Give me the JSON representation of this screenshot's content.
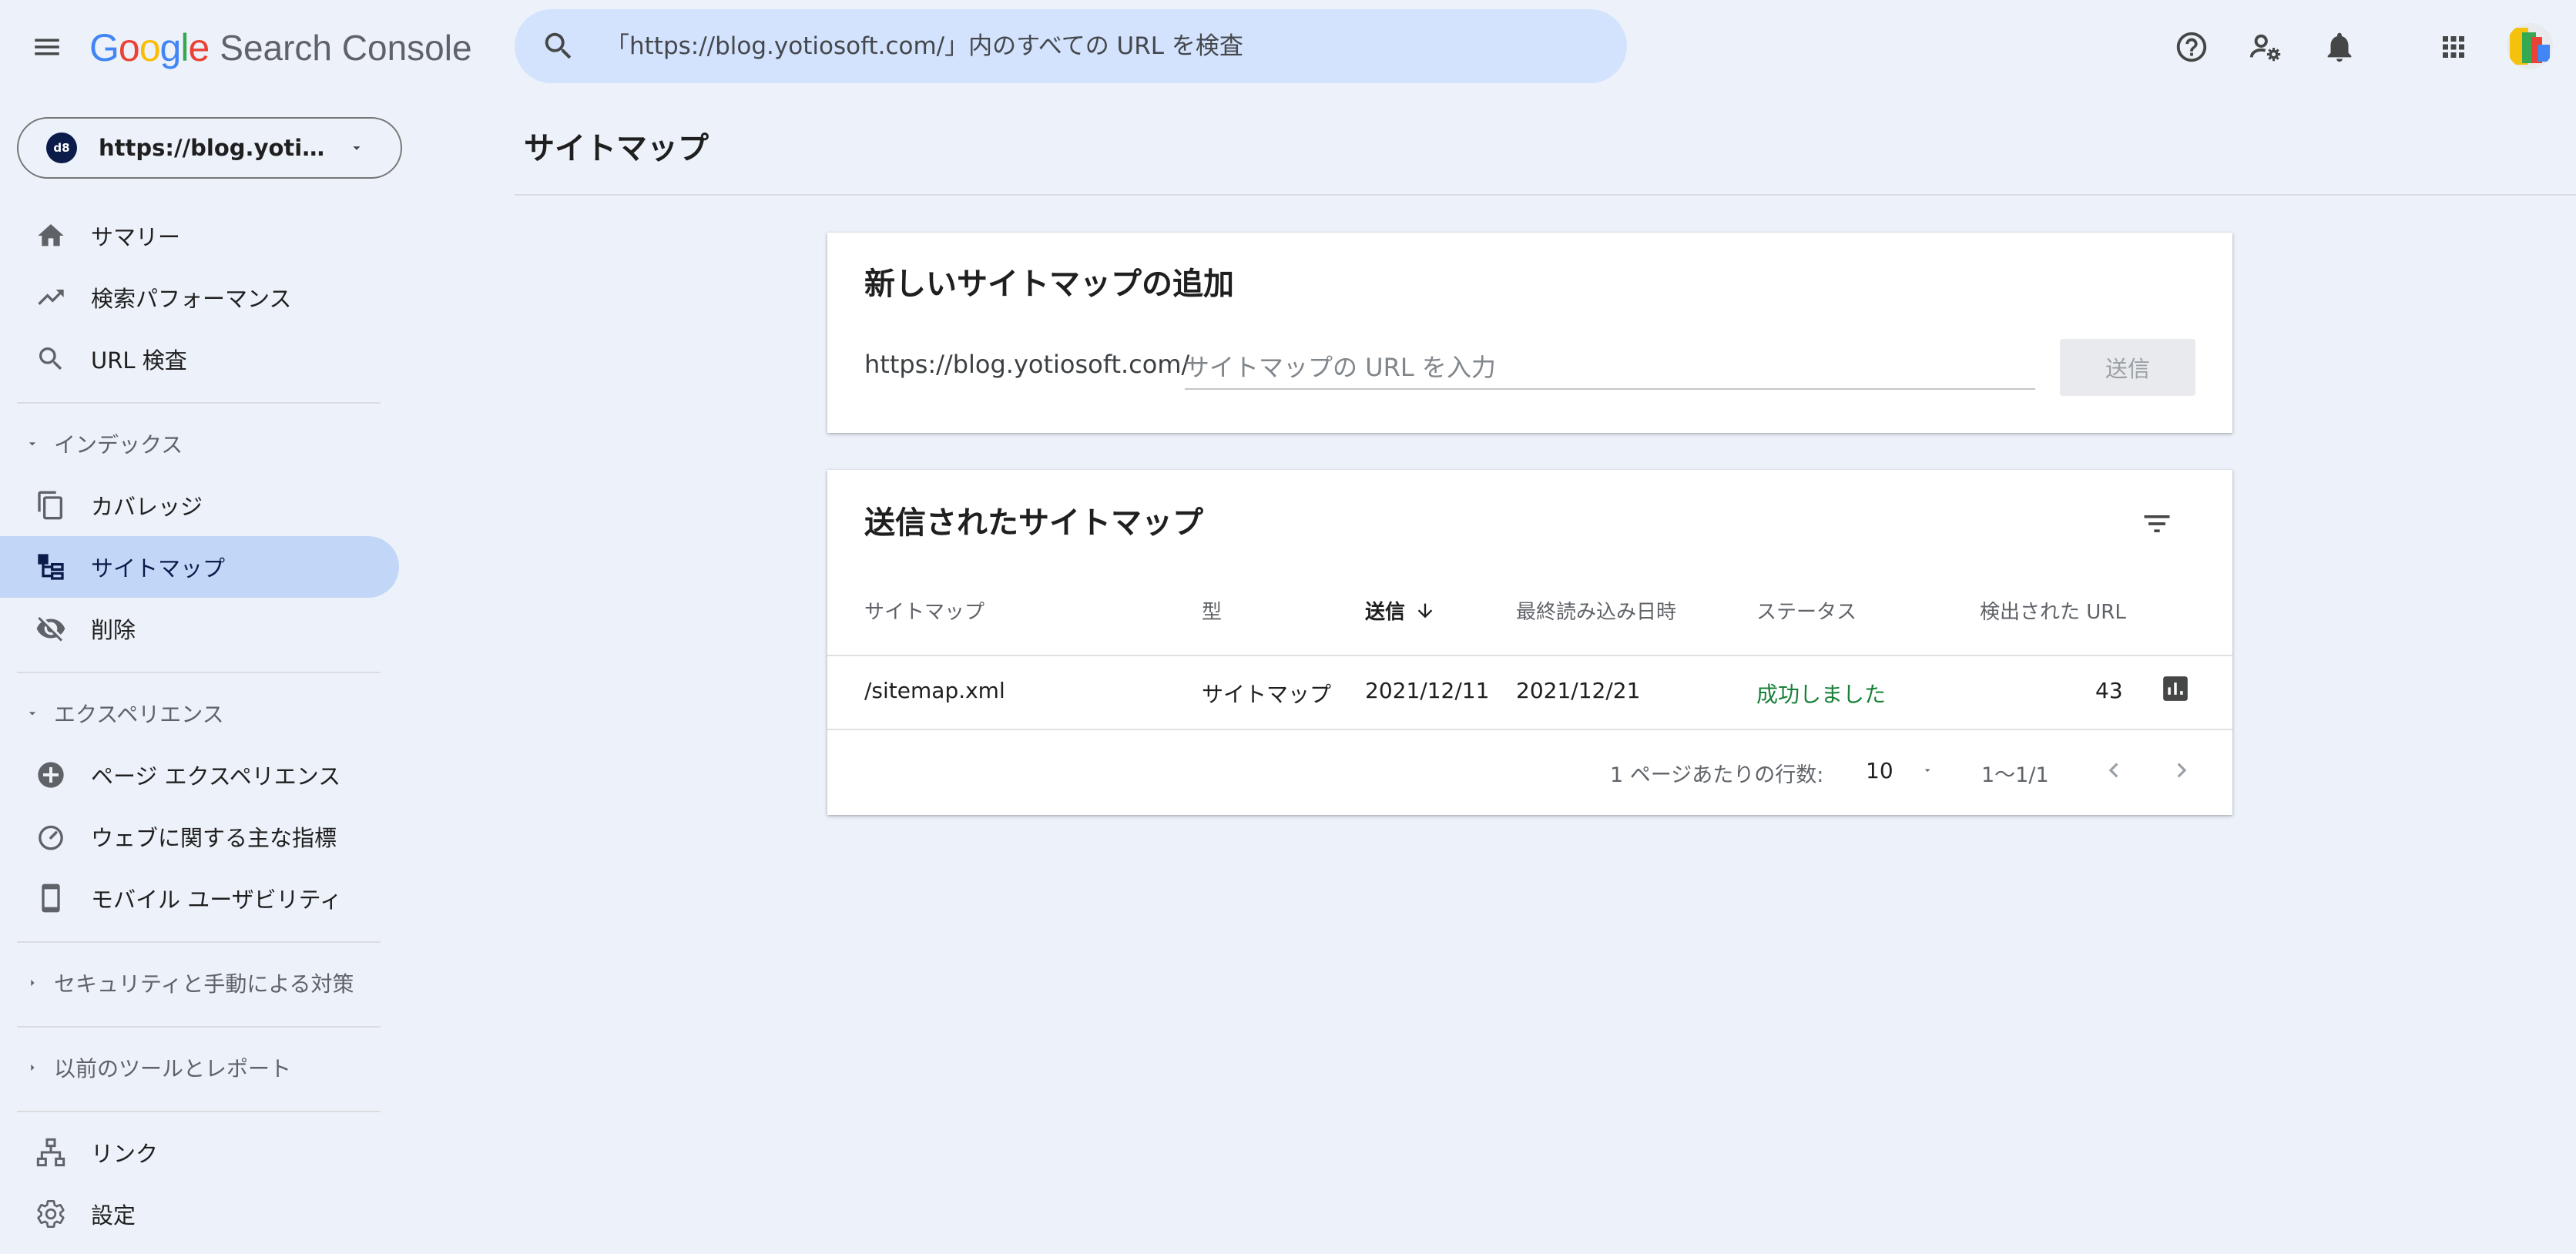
{
  "header": {
    "logo_letters": [
      {
        "ch": "G",
        "color": "#4285F4"
      },
      {
        "ch": "o",
        "color": "#EA4335"
      },
      {
        "ch": "o",
        "color": "#FBBC05"
      },
      {
        "ch": "g",
        "color": "#4285F4"
      },
      {
        "ch": "l",
        "color": "#34A853"
      },
      {
        "ch": "e",
        "color": "#EA4335"
      }
    ],
    "product_name": "Search Console",
    "search_placeholder": "「https://blog.yotiosoft.com/」内のすべての URL を検査",
    "icons": [
      "help-icon",
      "manage-users-icon",
      "notifications-icon",
      "apps-grid-icon",
      "account-avatar"
    ]
  },
  "property": {
    "logo_text": "d8",
    "label": "https://blog.yotiosoft.com/"
  },
  "sidebar": {
    "top_items": [
      {
        "label": "サマリー",
        "icon": "home-icon"
      },
      {
        "label": "検索パフォーマンス",
        "icon": "trending-up-icon"
      },
      {
        "label": "URL 検査",
        "icon": "search-icon"
      }
    ],
    "index_section": {
      "label": "インデックス",
      "items": [
        {
          "label": "カバレッジ",
          "icon": "coverage-icon"
        },
        {
          "label": "サイトマップ",
          "icon": "sitemap-icon",
          "active": true
        },
        {
          "label": "削除",
          "icon": "visibility-off-icon"
        }
      ]
    },
    "experience_section": {
      "label": "エクスペリエンス",
      "items": [
        {
          "label": "ページ エクスペリエンス",
          "icon": "page-experience-icon"
        },
        {
          "label": "ウェブに関する主な指標",
          "icon": "speed-gauge-icon"
        },
        {
          "label": "モバイル ユーザビリティ",
          "icon": "mobile-icon"
        }
      ]
    },
    "security_section": {
      "label": "セキュリティと手動による対策"
    },
    "legacy_section": {
      "label": "以前のツールとレポート"
    },
    "bottom_items": [
      {
        "label": "リンク",
        "icon": "links-icon"
      },
      {
        "label": "設定",
        "icon": "settings-icon"
      }
    ]
  },
  "main": {
    "page_title": "サイトマップ",
    "add_card": {
      "title": "新しいサイトマップの追加",
      "url_prefix": "https://blog.yotiosoft.com/",
      "input_placeholder": "サイトマップの URL を入力",
      "input_value": "",
      "submit_label": "送信"
    },
    "submitted_card": {
      "title": "送信されたサイトマップ",
      "columns": [
        "サイトマップ",
        "型",
        "送信",
        "最終読み込み日時",
        "ステータス",
        "検出された URL"
      ],
      "sorted_column": "送信",
      "rows": [
        {
          "sitemap": "/sitemap.xml",
          "type": "サイトマップ",
          "submitted": "2021/12/11",
          "last_read": "2021/12/21",
          "status": "成功しました",
          "discovered_urls": "43"
        }
      ],
      "pagination": {
        "rows_per_page_label": "1 ページあたりの行数:",
        "rows_per_page": "10",
        "range": "1〜1/1"
      }
    }
  },
  "colors": {
    "background": "#edf2fa",
    "search_bar": "#d3e3fd",
    "active_nav": "#c2d7f8",
    "status_success": "#188038"
  }
}
